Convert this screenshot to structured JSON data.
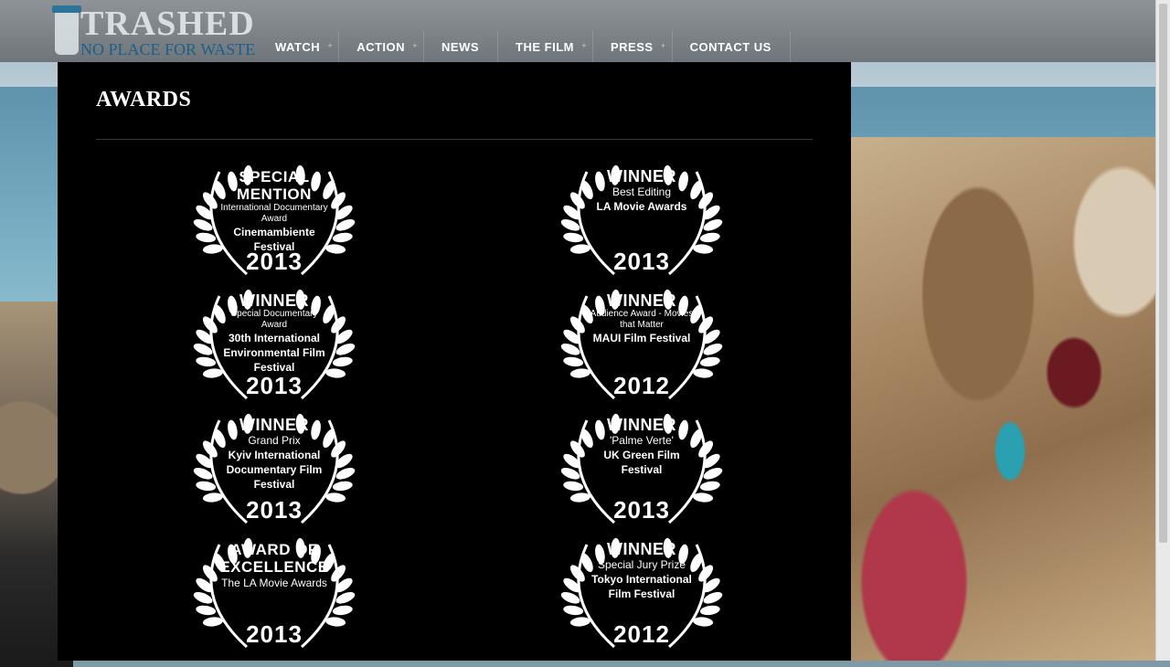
{
  "logo": {
    "word": "TRASHED",
    "tagline": "NO PLACE FOR WASTE"
  },
  "nav": [
    {
      "label": "WATCH",
      "has_submenu": true
    },
    {
      "label": "ACTION",
      "has_submenu": true
    },
    {
      "label": "NEWS",
      "has_submenu": false
    },
    {
      "label": "THE FILM",
      "has_submenu": true
    },
    {
      "label": "PRESS",
      "has_submenu": true
    },
    {
      "label": "CONTACT US",
      "has_submenu": false
    }
  ],
  "page": {
    "title": "AWARDS"
  },
  "awards": [
    {
      "head": "SPECIAL MENTION",
      "line1": "International Documentary Award",
      "line2": "Cinemambiente Festival",
      "line3": "",
      "year": "2013"
    },
    {
      "head": "WINNER",
      "line1": "Best Editing",
      "line2": "LA Movie Awards",
      "line3": "",
      "year": "2013"
    },
    {
      "head": "WINNER",
      "line1": "Special Documentary Award",
      "line2": "30th International Environmental Film Festival",
      "line3": "",
      "year": "2013"
    },
    {
      "head": "WINNER",
      "line1": "Audience Award - Movies that Matter",
      "line2": "MAUI Film Festival",
      "line3": "",
      "year": "2012"
    },
    {
      "head": "WINNER",
      "line1": "Grand Prix",
      "line2": "Kyiv International Documentary Film Festival",
      "line3": "",
      "year": "2013"
    },
    {
      "head": "WINNER",
      "line1": "'Palme Verte'",
      "line2": "UK Green Film Festival",
      "line3": "",
      "year": "2013"
    },
    {
      "head": "AWARD OF EXCELLENCE",
      "line1": "The LA Movie Awards",
      "line2": "",
      "line3": "",
      "year": "2013"
    },
    {
      "head": "WINNER",
      "line1": "Special Jury Prize",
      "line2": "Tokyo International Film Festival",
      "line3": "",
      "year": "2012"
    }
  ]
}
